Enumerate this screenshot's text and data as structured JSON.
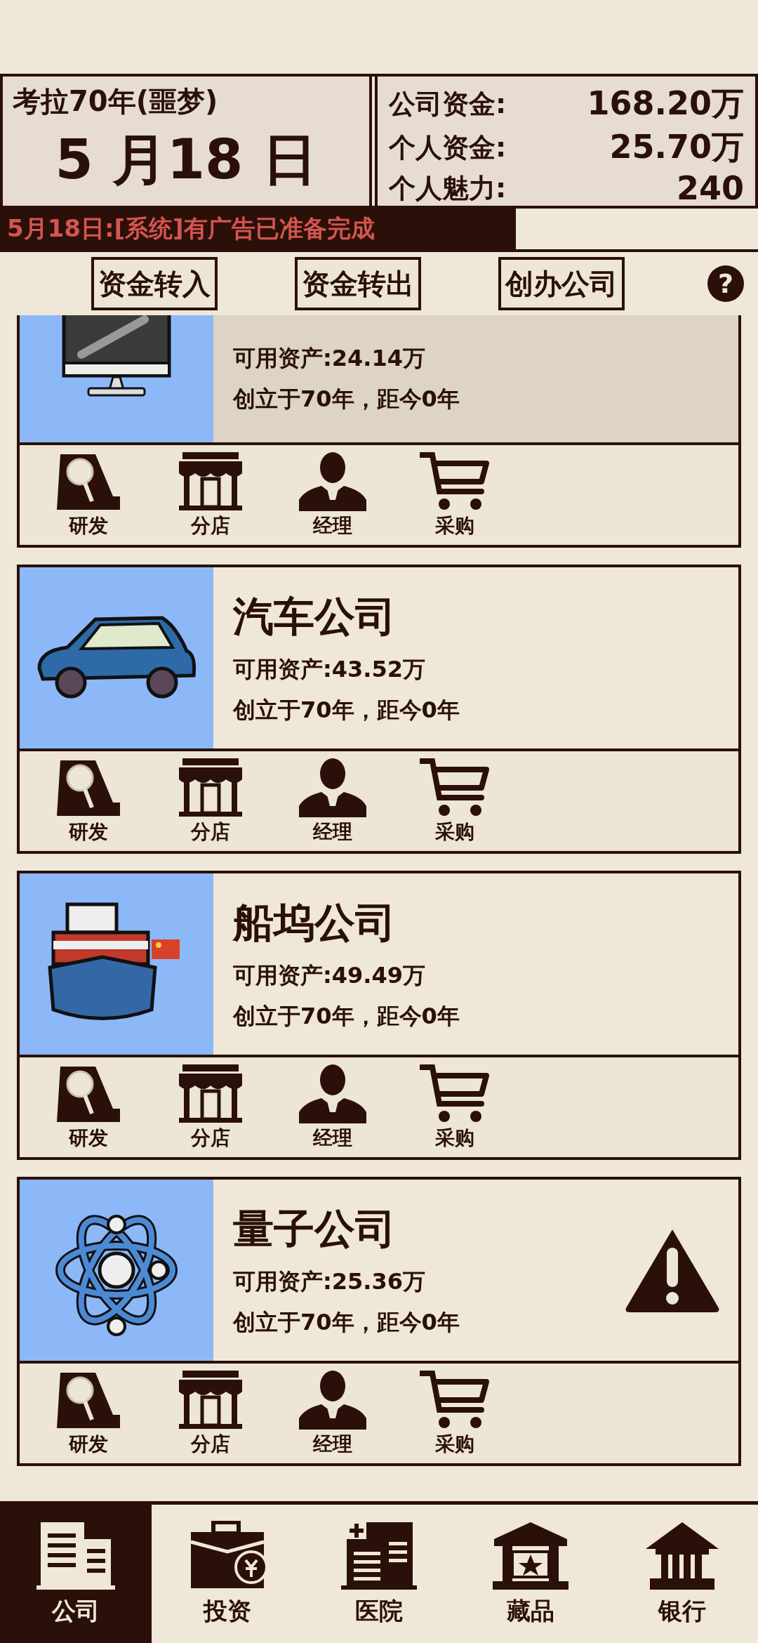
{
  "header": {
    "era": "考拉70年(噩梦)",
    "date": "5 月18 日",
    "stats": [
      {
        "label": "公司资金:",
        "value": "168.20万"
      },
      {
        "label": "个人资金:",
        "value": "25.70万"
      },
      {
        "label": "个人魅力:",
        "value": "240"
      }
    ]
  },
  "message": "5月18日:[系统]有广告已准备完成",
  "actions": [
    "资金转入",
    "资金转出",
    "创办公司"
  ],
  "help": "?",
  "companies": [
    {
      "kind": "monitor",
      "assets": "可用资产:24.14万",
      "founded": "创立于70年，距今0年",
      "highlighted": true,
      "warning": false,
      "actions": [
        {
          "kind": "research",
          "label": "研发"
        },
        {
          "kind": "shop",
          "label": "分店"
        },
        {
          "kind": "manager",
          "label": "经理"
        },
        {
          "kind": "purchase",
          "label": "采购"
        }
      ]
    },
    {
      "kind": "car",
      "name": "汽车公司",
      "assets": "可用资产:43.52万",
      "founded": "创立于70年，距今0年",
      "highlighted": false,
      "warning": false,
      "actions": [
        {
          "kind": "research",
          "label": "研发"
        },
        {
          "kind": "shop",
          "label": "分店"
        },
        {
          "kind": "manager",
          "label": "经理"
        },
        {
          "kind": "purchase",
          "label": "采购"
        }
      ]
    },
    {
      "kind": "ship",
      "name": "船坞公司",
      "assets": "可用资产:49.49万",
      "founded": "创立于70年，距今0年",
      "highlighted": false,
      "warning": false,
      "actions": [
        {
          "kind": "research",
          "label": "研发"
        },
        {
          "kind": "shop",
          "label": "分店"
        },
        {
          "kind": "manager",
          "label": "经理"
        },
        {
          "kind": "purchase",
          "label": "采购"
        }
      ]
    },
    {
      "kind": "atom",
      "name": "量子公司",
      "assets": "可用资产:25.36万",
      "founded": "创立于70年，距今0年",
      "highlighted": false,
      "warning": true,
      "actions": [
        {
          "kind": "research",
          "label": "研发"
        },
        {
          "kind": "shop",
          "label": "分店"
        },
        {
          "kind": "manager",
          "label": "经理"
        },
        {
          "kind": "purchase",
          "label": "采购"
        }
      ]
    }
  ],
  "nav": [
    {
      "kind": "company",
      "label": "公司",
      "selected": true
    },
    {
      "kind": "invest",
      "label": "投资",
      "selected": false
    },
    {
      "kind": "hospital",
      "label": "医院",
      "selected": false
    },
    {
      "kind": "collection",
      "label": "藏品",
      "selected": false
    },
    {
      "kind": "bank",
      "label": "银行",
      "selected": false
    }
  ]
}
